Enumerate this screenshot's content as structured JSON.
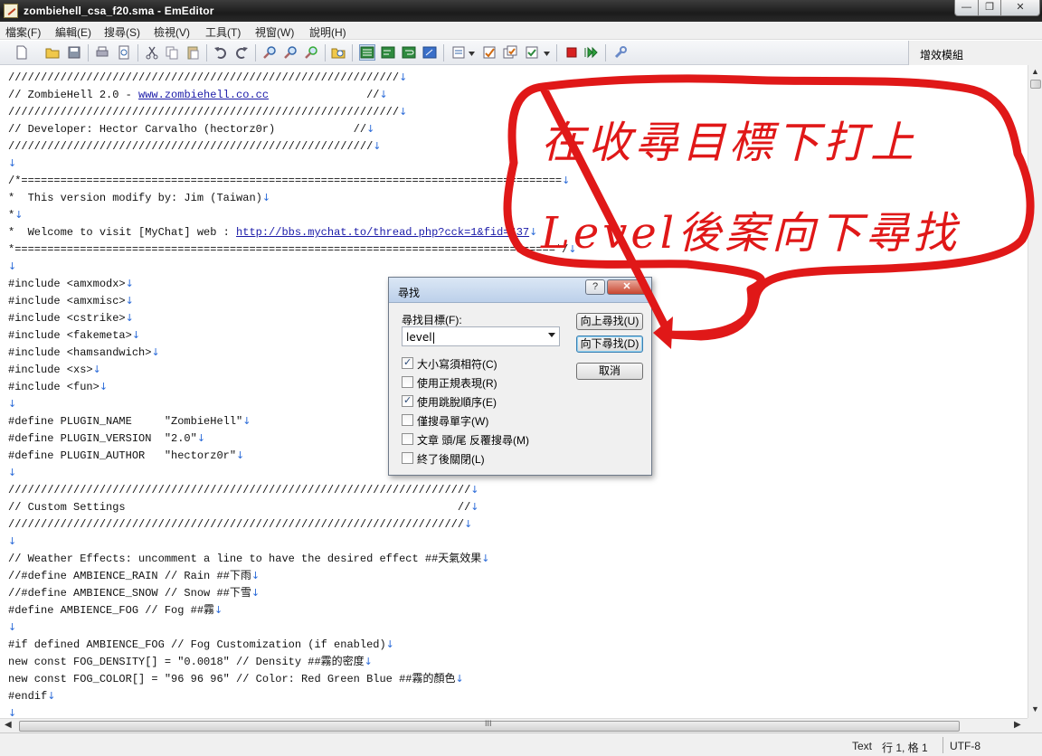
{
  "window": {
    "title": "zombiehell_csa_f20.sma - EmEditor",
    "minimize": "—",
    "maximize": "❐",
    "close": "✕"
  },
  "menu": [
    "檔案(F)",
    "編輯(E)",
    "搜尋(S)",
    "檢視(V)",
    "工具(T)",
    "視窗(W)",
    "說明(H)"
  ],
  "plugin_panel": "增效模組",
  "editor": {
    "cr": "↓",
    "lines": [
      {
        "t": "////////////////////////////////////////////////////////////"
      },
      {
        "t": "// ZombieHell 2.0 - ",
        "link": "www.zombiehell.co.cc",
        "after": "               //"
      },
      {
        "t": "////////////////////////////////////////////////////////////"
      },
      {
        "t": "// Developer: Hector Carvalho (hectorz0r)            //"
      },
      {
        "t": "////////////////////////////////////////////////////////"
      },
      {
        "t": ""
      },
      {
        "t": "/*==================================================================================="
      },
      {
        "t": "*  This version modify by: Jim (Taiwan)"
      },
      {
        "t": "*"
      },
      {
        "t": "*  Welcome to visit [MyChat] web : ",
        "link": "http://bbs.mychat.to/thread.php?cck=1&fid=437"
      },
      {
        "t": "*===================================================================================*/"
      },
      {
        "t": ""
      },
      {
        "t": "#include <amxmodx>"
      },
      {
        "t": "#include <amxmisc>"
      },
      {
        "t": "#include <cstrike>"
      },
      {
        "t": "#include <fakemeta>"
      },
      {
        "t": "#include <hamsandwich>"
      },
      {
        "t": "#include <xs>"
      },
      {
        "t": "#include <fun>"
      },
      {
        "t": ""
      },
      {
        "t": "#define PLUGIN_NAME     \"ZombieHell\""
      },
      {
        "t": "#define PLUGIN_VERSION  \"2.0\""
      },
      {
        "t": "#define PLUGIN_AUTHOR   \"hectorz0r\""
      },
      {
        "t": ""
      },
      {
        "t": "///////////////////////////////////////////////////////////////////////"
      },
      {
        "t": "// Custom Settings                                                   //"
      },
      {
        "t": "//////////////////////////////////////////////////////////////////////"
      },
      {
        "t": ""
      },
      {
        "t": "// Weather Effects: uncomment a line to have the desired effect ##天氣效果"
      },
      {
        "t": "//#define AMBIENCE_RAIN // Rain ##下雨"
      },
      {
        "t": "//#define AMBIENCE_SNOW // Snow ##下雪"
      },
      {
        "t": "#define AMBIENCE_FOG // Fog ##霧"
      },
      {
        "t": ""
      },
      {
        "t": "#if defined AMBIENCE_FOG // Fog Customization (if enabled)"
      },
      {
        "t": "new const FOG_DENSITY[] = \"0.0018\" // Density ##霧的密度"
      },
      {
        "t": "new const FOG_COLOR[] = \"96 96 96\" // Color: Red Green Blue ##霧的顏色"
      },
      {
        "t": "#endif"
      },
      {
        "t": ""
      }
    ]
  },
  "find_dialog": {
    "title": "尋找",
    "help": "?",
    "close": "✕",
    "target_label": "尋找目標(F):",
    "target_value": "level|",
    "btn_up": "向上尋找(U)",
    "btn_down": "向下尋找(D)",
    "btn_cancel": "取消",
    "options": [
      {
        "label": "大小寫須相符(C)",
        "checked": true
      },
      {
        "label": "使用正規表現(R)",
        "checked": false
      },
      {
        "label": "使用跳脫順序(E)",
        "checked": true
      },
      {
        "label": "僅搜尋單字(W)",
        "checked": false
      },
      {
        "label": "文章 頭/尾 反覆搜尋(M)",
        "checked": false
      },
      {
        "label": "終了後關閉(L)",
        "checked": false
      }
    ]
  },
  "annotation": {
    "line1": "在收尋目標下打上",
    "line2": "Level後案向下尋找",
    "color": "#e01818"
  },
  "status": {
    "mode": "Text",
    "position": "行 1, 格 1",
    "encoding": "UTF-8"
  },
  "scroll": {
    "grip": "III"
  }
}
